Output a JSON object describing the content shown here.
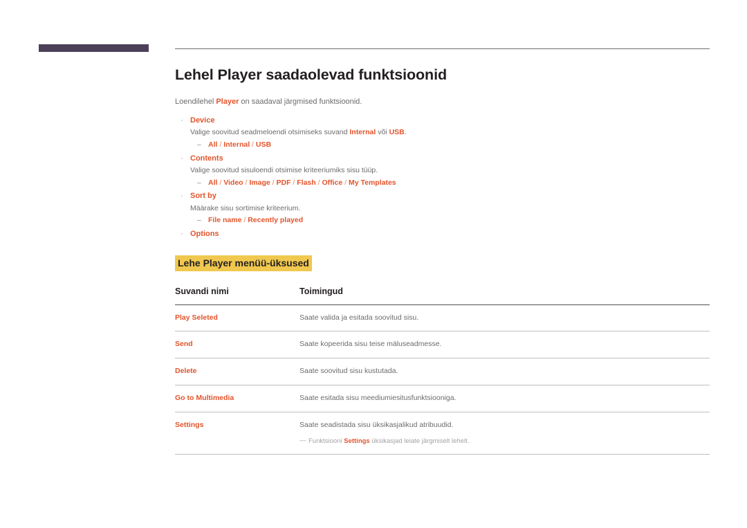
{
  "decor": {
    "bar_color": "#4a4158",
    "rule_color": "#6e6e72",
    "accent_color": "#e2542c",
    "highlight_color": "#f0c84f"
  },
  "page": {
    "title": "Lehel Player saadaolevad funktsioonid",
    "intro_prefix": "Loendilehel ",
    "intro_accent": "Player",
    "intro_suffix": " on saadaval järgmised funktsioonid."
  },
  "bullets": [
    {
      "marker": "·",
      "label": "Device",
      "desc_prefix": "Valige soovitud seadmeloendi otsimiseks suvand ",
      "desc_accent1": "Internal",
      "desc_middle": " või ",
      "desc_accent2": "USB",
      "desc_suffix": ".",
      "sub_marker": "–",
      "options": [
        "All",
        "Internal",
        "USB"
      ],
      "separator": " / "
    },
    {
      "marker": "·",
      "label": "Contents",
      "desc_prefix": "Valige soovitud sisuloendi otsimise kriteeriumiks sisu tüüp.",
      "desc_accent1": "",
      "desc_middle": "",
      "desc_accent2": "",
      "desc_suffix": "",
      "sub_marker": "–",
      "options": [
        "All",
        "Video",
        "Image",
        "PDF",
        "Flash",
        "Office",
        "My Templates"
      ],
      "separator": " / "
    },
    {
      "marker": "·",
      "label": "Sort by",
      "desc_prefix": "Määrake sisu sortimise kriteerium.",
      "desc_accent1": "",
      "desc_middle": "",
      "desc_accent2": "",
      "desc_suffix": "",
      "sub_marker": "–",
      "options": [
        "File name",
        "Recently played"
      ],
      "separator": " / "
    },
    {
      "marker": "·",
      "label": "Options",
      "desc_prefix": "",
      "desc_accent1": "",
      "desc_middle": "",
      "desc_accent2": "",
      "desc_suffix": "",
      "sub_marker": "",
      "options": [],
      "separator": " / "
    }
  ],
  "section_heading": "Lehe Player menüü-üksused",
  "table": {
    "headers": [
      "Suvandi nimi",
      "Toimingud"
    ],
    "rows": [
      {
        "name": "Play Seleted",
        "action": "Saate valida ja esitada soovitud sisu."
      },
      {
        "name": "Send",
        "action": "Saate kopeerida sisu teise mäluseadmesse."
      },
      {
        "name": "Delete",
        "action": "Saate soovitud sisu kustutada."
      },
      {
        "name": "Go to Multimedia",
        "action": "Saate esitada sisu meediumiesitusfunktsiooniga."
      },
      {
        "name": "Settings",
        "action": "Saate seadistada sisu üksikasjalikud atribuudid."
      }
    ],
    "note": {
      "dash": "—",
      "prefix": "Funktsiooni ",
      "accent": "Settings",
      "suffix": " üksikasjad leiate järgmiselt lehelt."
    }
  }
}
